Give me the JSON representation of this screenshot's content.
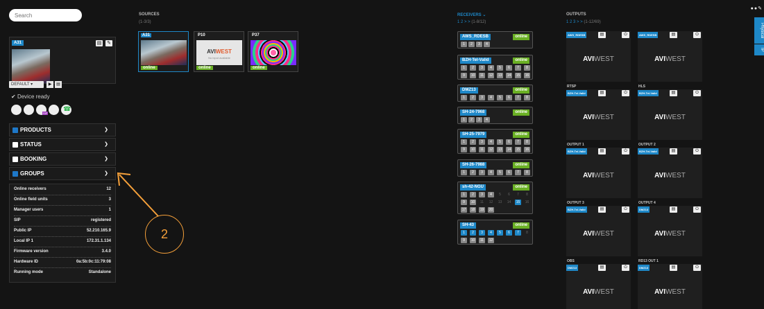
{
  "search": {
    "placeholder": "Search"
  },
  "device": {
    "name": "A31",
    "default_label": "DEFAULT",
    "status": "Device ready",
    "sip_badge": "SIP"
  },
  "accordions": [
    {
      "label": "PRODUCTS",
      "checked": true
    },
    {
      "label": "STATUS",
      "checked": false
    },
    {
      "label": "BOOKING",
      "checked": false
    },
    {
      "label": "GROUPS",
      "checked": true
    }
  ],
  "stats": [
    {
      "label": "Online receivers",
      "value": "12"
    },
    {
      "label": "Online field units",
      "value": "3"
    },
    {
      "label": "Manager users",
      "value": "1"
    },
    {
      "label": "SIP",
      "value": "registered"
    },
    {
      "label": "Public IP",
      "value": "52.210.165.9"
    },
    {
      "label": "Local IP 1",
      "value": "172.31.1.134"
    },
    {
      "label": "Firmware version",
      "value": "3.4.0"
    },
    {
      "label": "Hardware ID",
      "value": "0a:5b:0c:11:79:08"
    },
    {
      "label": "Running mode",
      "value": "Standalone"
    }
  ],
  "sources": {
    "title": "SOURCES",
    "count": "(1-3/3)",
    "items": [
      {
        "name": "A31",
        "status": "online"
      },
      {
        "name": "P10",
        "status": "online",
        "logo_a": "AVI",
        "logo_b": "WEST",
        "no_input": "No input available"
      },
      {
        "name": "P37",
        "status": "online"
      }
    ]
  },
  "receivers": {
    "title": "RECEIVERS",
    "pager": "1 2 > >",
    "count": "(1-8/12)",
    "items": [
      {
        "name": "AWS_RDESB",
        "status": "online"
      },
      {
        "name": "BZH-Tel-Valid",
        "status": "online"
      },
      {
        "name": "DMZ13",
        "status": "online"
      },
      {
        "name": "SH-24-7968",
        "status": "online"
      },
      {
        "name": "SH-25-7979",
        "status": "online"
      },
      {
        "name": "SH-26-7988",
        "status": "online"
      },
      {
        "name": "sh-42-NGU",
        "status": "online"
      },
      {
        "name": "SH-43",
        "status": "online"
      }
    ]
  },
  "outputs": {
    "title": "OUTPUTS",
    "pager": "1 2 3 > >",
    "count": "(1-12/69)",
    "logo_a": "AVI",
    "logo_b": "WEST",
    "items": [
      {
        "tag": "AWS_RDESB",
        "label": "RTSP"
      },
      {
        "tag": "AWS_RDESB",
        "label": "HLS"
      },
      {
        "tag": "BZH-Tel-Valid",
        "label": "OUTPUT 1"
      },
      {
        "tag": "BZH-Tel-Valid",
        "label": "OUTPUT 2"
      },
      {
        "tag": "BZH-Tel-Valid",
        "label": "OUTPUT 3"
      },
      {
        "tag": "BZH-Tel-Valid",
        "label": "OUTPUT 4"
      },
      {
        "tag": "BZH-Tel-Valid",
        "label": "OBS"
      },
      {
        "tag": "DMZ13",
        "label": "RD13 OUT 1"
      },
      {
        "tag": "DMZ13",
        "label": ""
      },
      {
        "tag": "DMZ13",
        "label": ""
      }
    ]
  },
  "side_tabs": {
    "physical": "Physical",
    "ip": "IP"
  },
  "annotation": {
    "number": "2"
  },
  "colors": {
    "accent": "#1e88c8",
    "online": "#6ab024",
    "annotation": "#f5a03a"
  }
}
